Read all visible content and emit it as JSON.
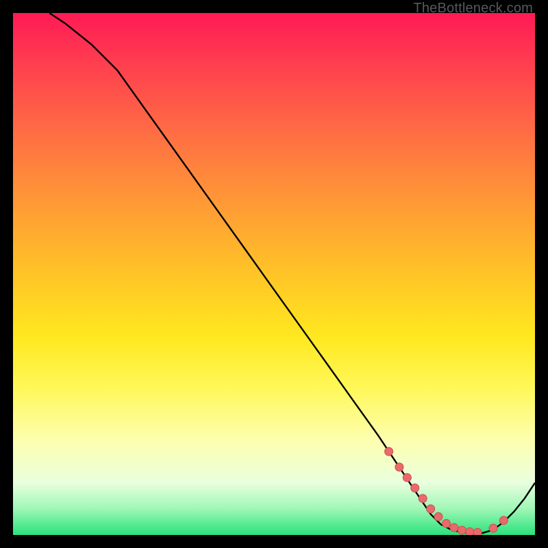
{
  "watermark": "TheBottleneck.com",
  "colors": {
    "curve": "#000000",
    "marker_fill": "#e86a6a",
    "marker_stroke": "#c94f4f",
    "background_top": "#ff1a55",
    "background_bottom": "#29e27a"
  },
  "chart_data": {
    "type": "line",
    "title": "",
    "xlabel": "",
    "ylabel": "",
    "xlim": [
      0,
      100
    ],
    "ylim": [
      0,
      100
    ],
    "grid": false,
    "legend": false,
    "series": [
      {
        "name": "bottleneck-curve",
        "x": [
          7,
          10,
          15,
          20,
          25,
          30,
          35,
          40,
          45,
          50,
          55,
          60,
          65,
          70,
          72,
          74,
          76,
          78,
          80,
          82,
          84,
          86,
          88,
          90,
          92,
          94,
          96,
          98,
          100
        ],
        "values": [
          100,
          98,
          94,
          89,
          82,
          75,
          68,
          61,
          54,
          47,
          40,
          33,
          26,
          19,
          16,
          13,
          10,
          7,
          4,
          2,
          1,
          0.5,
          0.3,
          0.4,
          1,
          2.5,
          4.5,
          7,
          10
        ]
      }
    ],
    "markers": {
      "name": "highlight-points",
      "x": [
        72,
        74,
        75.5,
        77,
        78.5,
        80,
        81.5,
        83,
        84.5,
        86,
        87.5,
        89,
        92,
        94
      ],
      "values": [
        16,
        13,
        11,
        9,
        7,
        5,
        3.5,
        2.2,
        1.4,
        0.9,
        0.6,
        0.5,
        1.3,
        2.8
      ]
    }
  }
}
